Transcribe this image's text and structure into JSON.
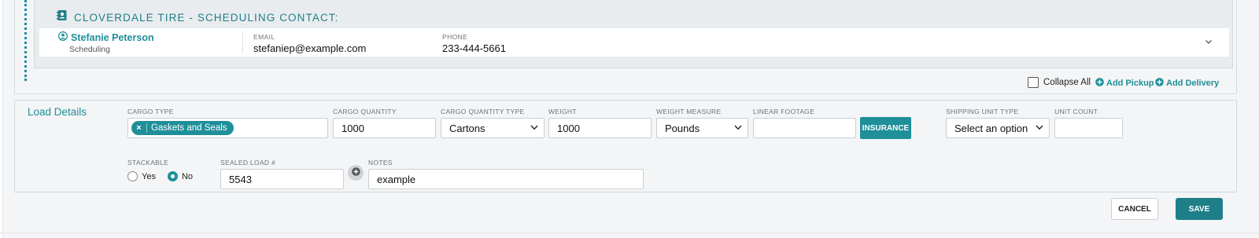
{
  "contact": {
    "title": "CLOVERDALE TIRE - SCHEDULING CONTACT:",
    "name": "Stefanie Peterson",
    "role": "Scheduling",
    "email_label": "EMAIL",
    "email": "stefaniep@example.com",
    "phone_label": "PHONE",
    "phone": "233-444-5661"
  },
  "actions": {
    "collapse_all": "Collapse All",
    "add_pickup": "Add Pickup",
    "add_delivery": "Add Delivery"
  },
  "load_details": {
    "title": "Load Details",
    "cargo_type_label": "CARGO TYPE",
    "cargo_type_tag": "Gaskets and Seals",
    "cargo_quantity_label": "CARGO QUANTITY",
    "cargo_quantity": "1000",
    "cargo_quantity_type_label": "CARGO QUANTITY TYPE",
    "cargo_quantity_type": "Cartons",
    "weight_label": "WEIGHT",
    "weight": "1000",
    "weight_measure_label": "WEIGHT MEASURE",
    "weight_measure": "Pounds",
    "linear_footage_label": "LINEAR FOOTAGE",
    "linear_footage": "",
    "insurance_button": "INSURANCE",
    "shipping_unit_type_label": "SHIPPING UNIT TYPE",
    "shipping_unit_type": "Select an option",
    "unit_count_label": "UNIT COUNT",
    "unit_count": "",
    "stackable_label": "STACKABLE",
    "stackable_yes": "Yes",
    "stackable_no": "No",
    "stackable_selected": "No",
    "sealed_load_label": "SEALED LOAD #",
    "sealed_load": "5543",
    "notes_label": "NOTES",
    "notes": "example"
  },
  "footer": {
    "cancel": "CANCEL",
    "save": "SAVE"
  },
  "colors": {
    "accent": "#1f8f99",
    "accent_dark": "#1f7f88"
  },
  "icons": {
    "contact_card": "address-book-icon",
    "person": "user-circle-icon",
    "chevron": "chevron-down-icon",
    "add": "plus-circle-icon",
    "remove_tag": "close-icon"
  }
}
